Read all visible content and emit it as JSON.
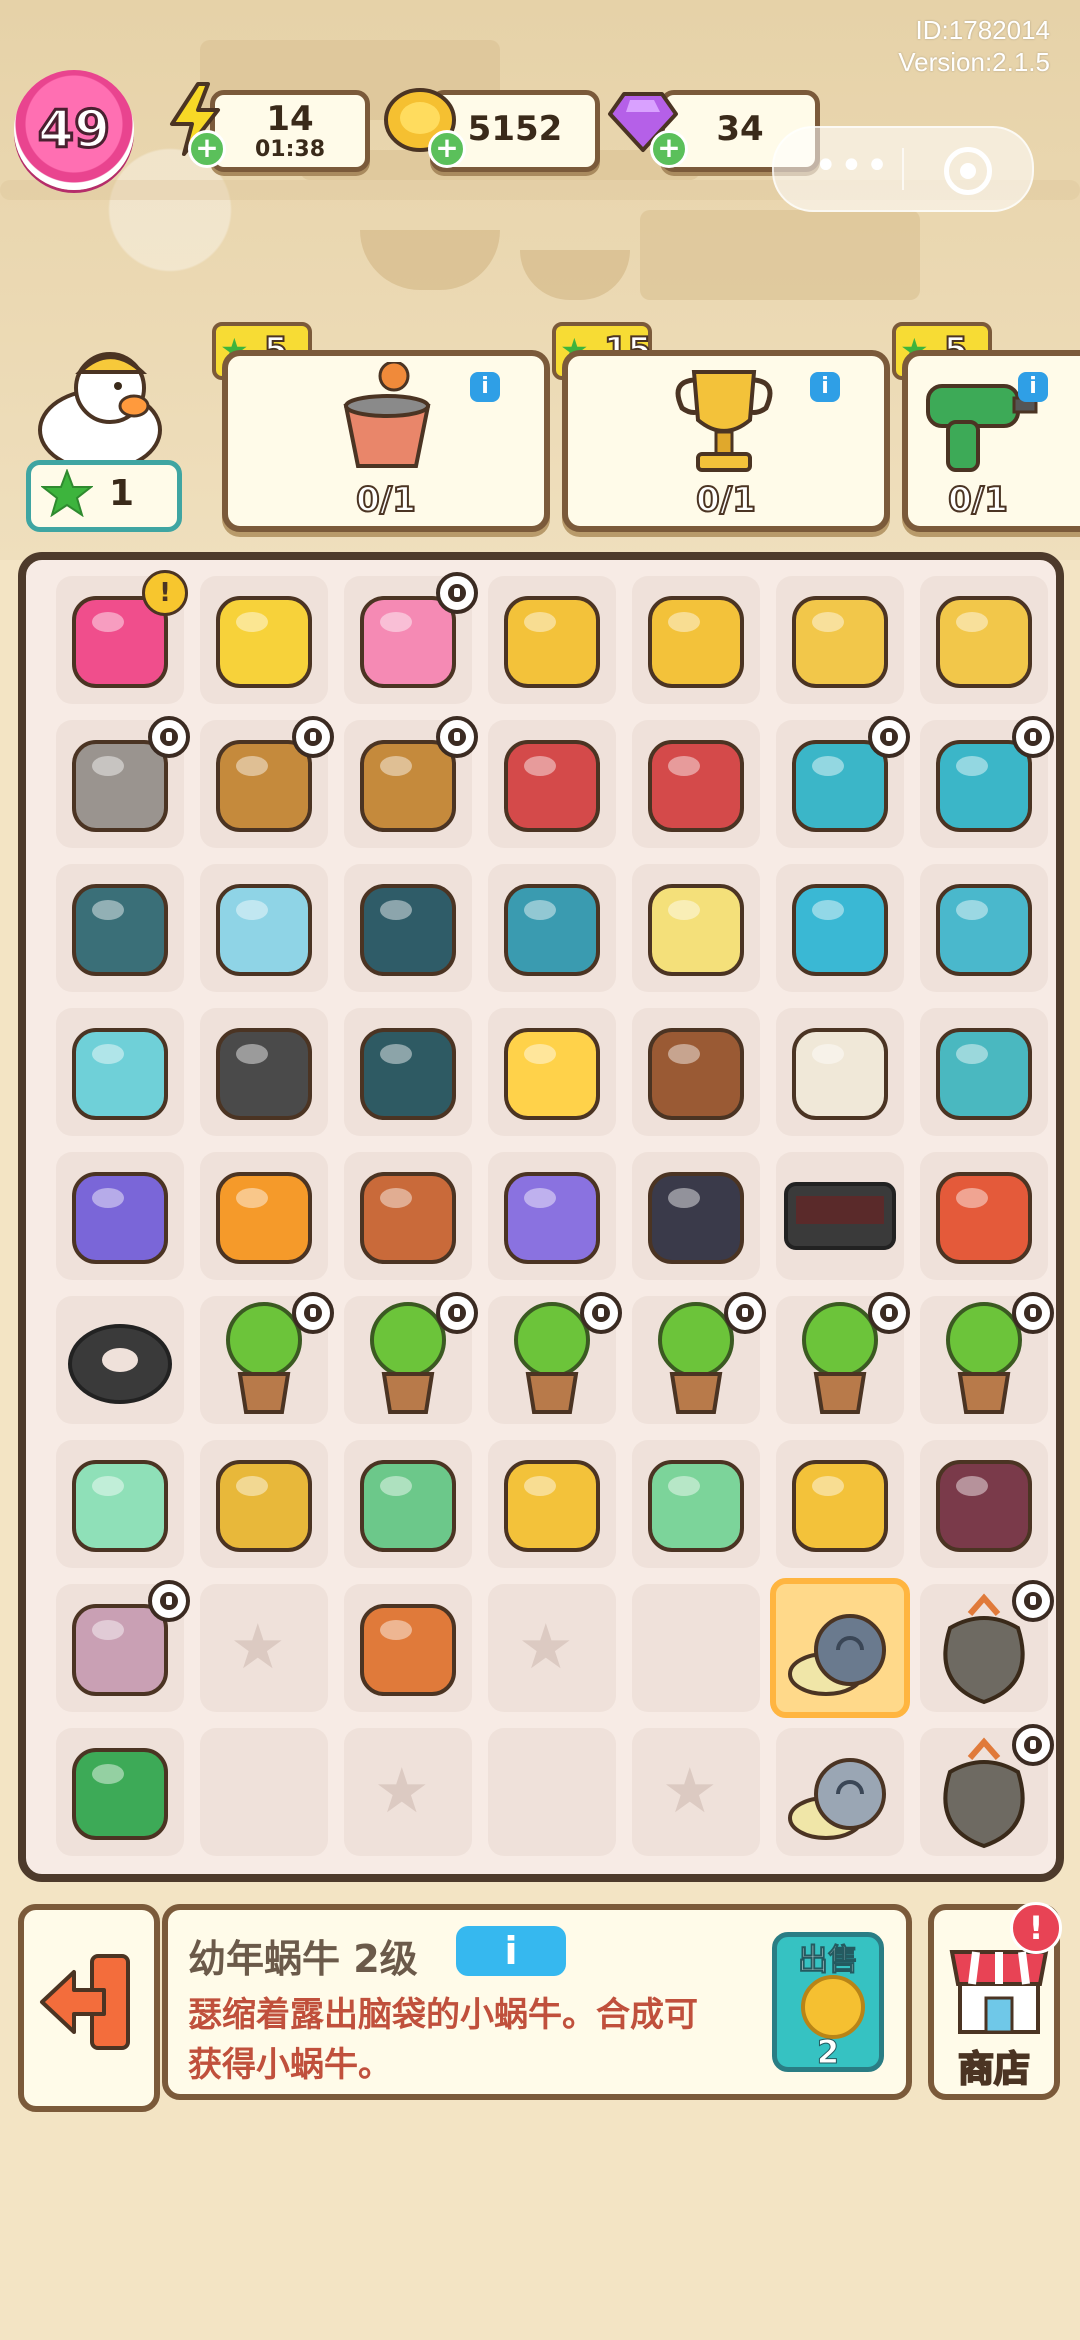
{
  "system": {
    "id": "ID:1782014",
    "version": "Version:2.1.5"
  },
  "header": {
    "level": "49",
    "energy": {
      "value": "14",
      "timer": "01:38"
    },
    "coins": "5152",
    "gems": "34"
  },
  "player": {
    "stars": "1"
  },
  "orders": [
    {
      "reward": "5",
      "progress": "0/1",
      "icon": "bucket-icon"
    },
    {
      "reward": "15",
      "progress": "0/1",
      "icon": "trophy-icon"
    },
    {
      "reward": "5",
      "progress": "0/1",
      "icon": "drill-icon"
    }
  ],
  "board": {
    "cells": [
      {
        "icon": "backpack-icon",
        "clock": false,
        "alert": true
      },
      {
        "icon": "duck-float-icon",
        "clock": false
      },
      {
        "icon": "flamingo-float-icon",
        "clock": true
      },
      {
        "icon": "cart-icon",
        "clock": false
      },
      {
        "icon": "duck-cart-icon",
        "clock": false
      },
      {
        "icon": "empty-pot-icon",
        "clock": false
      },
      {
        "icon": "sprout-pot-icon",
        "clock": false
      },
      {
        "icon": "squirrel-statue-icon",
        "clock": true
      },
      {
        "icon": "flower-basket-icon",
        "clock": true
      },
      {
        "icon": "flower-basket-icon",
        "clock": true
      },
      {
        "icon": "tool-wheelbarrow-icon",
        "clock": false
      },
      {
        "icon": "tool-wheelbarrow-icon",
        "clock": false
      },
      {
        "icon": "gym-cart-icon",
        "clock": true
      },
      {
        "icon": "gym-cart-icon",
        "clock": true
      },
      {
        "icon": "closed-sign-icon",
        "clock": false
      },
      {
        "icon": "clipboard-icon",
        "clock": false
      },
      {
        "icon": "weight-plates-icon",
        "clock": false
      },
      {
        "icon": "exercise-bench-icon",
        "clock": false
      },
      {
        "icon": "yarn-mat-icon",
        "clock": false
      },
      {
        "icon": "hula-hoop-icon",
        "clock": false
      },
      {
        "icon": "bench-press-icon",
        "clock": false
      },
      {
        "icon": "building-icon",
        "clock": false
      },
      {
        "icon": "frying-pan-icon",
        "clock": false
      },
      {
        "icon": "lifeguard-chair-icon",
        "clock": false
      },
      {
        "icon": "lemonade-icon",
        "clock": false
      },
      {
        "icon": "firewood-icon",
        "clock": false
      },
      {
        "icon": "photos-icon",
        "clock": false
      },
      {
        "icon": "open-sign-icon",
        "clock": false
      },
      {
        "icon": "ball-machine-icon",
        "clock": false
      },
      {
        "icon": "jersey-icon",
        "clock": false
      },
      {
        "icon": "shop-house-icon",
        "clock": false
      },
      {
        "icon": "tablet-map-icon",
        "clock": false
      },
      {
        "icon": "scoreboard-icon",
        "clock": false
      },
      {
        "icon": "digital-clock-icon",
        "clock": false
      },
      {
        "icon": "basketball-hoop-icon",
        "clock": false
      },
      {
        "icon": "tire-icon",
        "clock": false
      },
      {
        "icon": "potted-tree-icon",
        "clock": true
      },
      {
        "icon": "potted-tree-icon",
        "clock": true
      },
      {
        "icon": "potted-tree-icon",
        "clock": true
      },
      {
        "icon": "potted-tree-icon",
        "clock": true
      },
      {
        "icon": "potted-tree-icon",
        "clock": true
      },
      {
        "icon": "potted-tree-icon",
        "clock": true
      },
      {
        "icon": "hair-clipper-icon",
        "clock": false
      },
      {
        "icon": "ribbon-medal-icon",
        "clock": false
      },
      {
        "icon": "cash-icon",
        "clock": false
      },
      {
        "icon": "gold-medal-icon",
        "clock": false
      },
      {
        "icon": "money-stack-icon",
        "clock": false
      },
      {
        "icon": "crown-medal-icon",
        "clock": false
      },
      {
        "icon": "money-case-icon",
        "clock": false
      },
      {
        "icon": "laptop-icon",
        "clock": true
      },
      {
        "icon": "empty",
        "clock": false
      },
      {
        "icon": "pickaxe-icon",
        "clock": false
      },
      {
        "icon": "empty",
        "clock": false
      },
      {
        "icon": "blank",
        "clock": false
      },
      {
        "icon": "snail-shell-icon",
        "clock": false,
        "selected": true
      },
      {
        "icon": "fish-sack-icon",
        "clock": true
      },
      {
        "icon": "toolbox-icon",
        "clock": false
      },
      {
        "icon": "blank",
        "clock": false
      },
      {
        "icon": "empty",
        "clock": false
      },
      {
        "icon": "blank",
        "clock": false
      },
      {
        "icon": "empty",
        "clock": false
      },
      {
        "icon": "baby-snail-icon",
        "clock": false
      },
      {
        "icon": "fish-sack-icon",
        "clock": true
      }
    ]
  },
  "panel": {
    "item_name": "幼年蜗牛 2级",
    "info_label": "i",
    "description": "瑟缩着露出脑袋的小蜗牛。合成可获得小蜗牛。",
    "sell_label": "出售",
    "sell_price": "2",
    "shop_label": "商店",
    "shop_alert": "!"
  },
  "colors": {
    "accent": "#36c2c2",
    "frame": "#7b5a3a",
    "info": "#36b8ef",
    "desc": "#c0503c"
  }
}
